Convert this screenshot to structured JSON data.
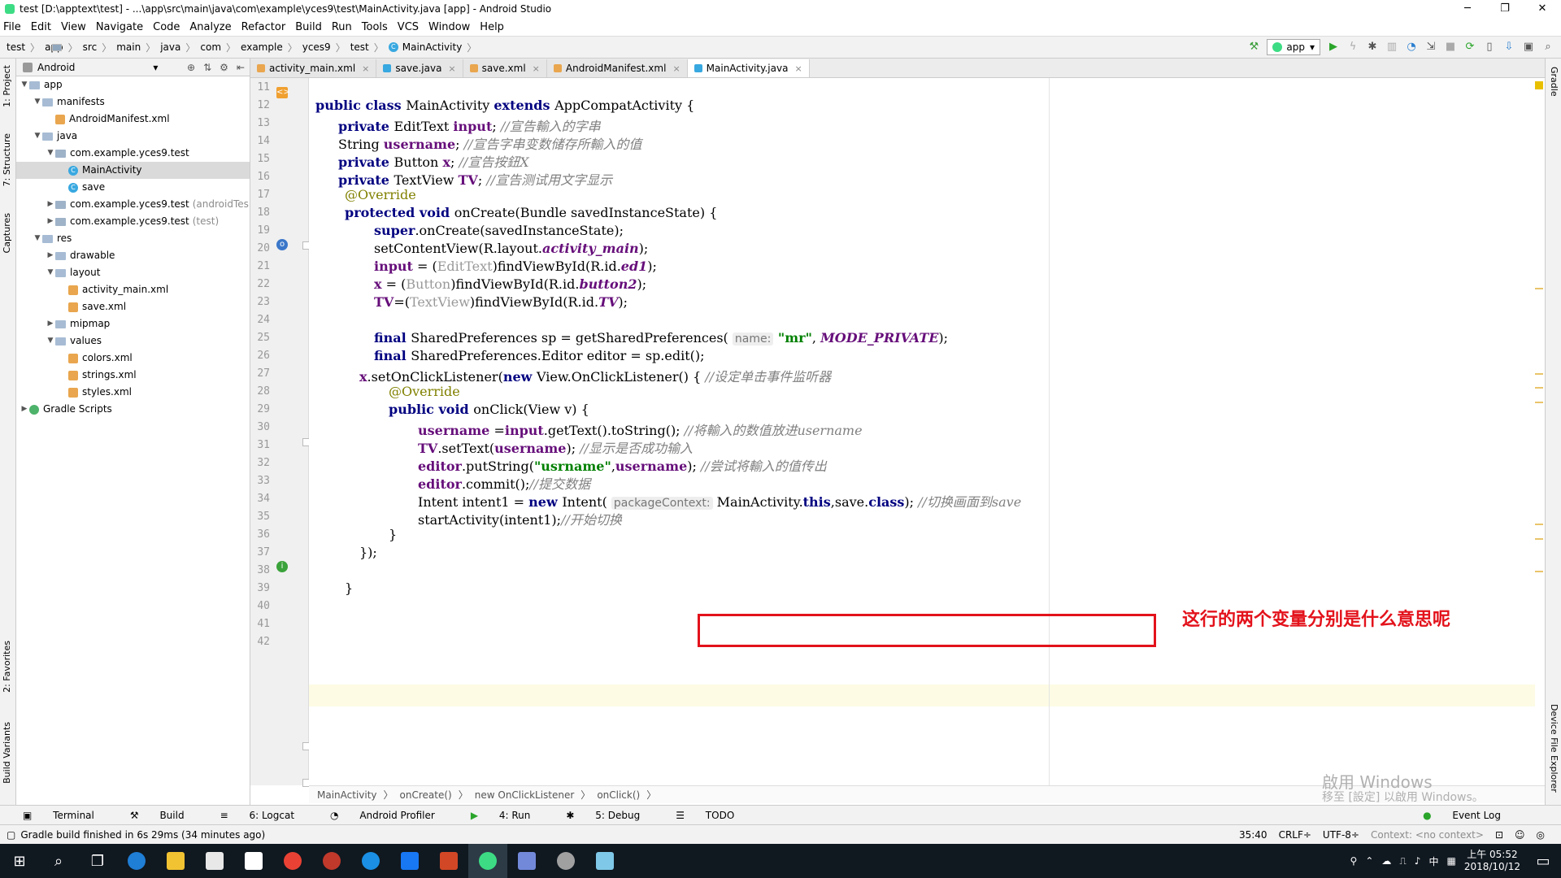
{
  "window": {
    "title": "test [D:\\apptext\\test] - ...\\app\\src\\main\\java\\com\\example\\yces9\\test\\MainActivity.java [app] - Android Studio"
  },
  "menu": [
    "File",
    "Edit",
    "View",
    "Navigate",
    "Code",
    "Analyze",
    "Refactor",
    "Build",
    "Run",
    "Tools",
    "VCS",
    "Window",
    "Help"
  ],
  "breadcrumbs": [
    "test",
    "app",
    "src",
    "main",
    "java",
    "com",
    "example",
    "yces9",
    "test",
    "MainActivity"
  ],
  "run_config": "app",
  "project_panel": {
    "mode": "Android",
    "tree": [
      {
        "label": "app",
        "depth": 0,
        "icon": "folder",
        "arrow": "v"
      },
      {
        "label": "manifests",
        "depth": 1,
        "icon": "folder",
        "arrow": "v"
      },
      {
        "label": "AndroidManifest.xml",
        "depth": 2,
        "icon": "xml",
        "arrow": ""
      },
      {
        "label": "java",
        "depth": 1,
        "icon": "folder",
        "arrow": "v"
      },
      {
        "label": "com.example.yces9.test",
        "depth": 2,
        "icon": "pkg",
        "arrow": "v"
      },
      {
        "label": "MainActivity",
        "depth": 3,
        "icon": "cls",
        "arrow": "",
        "selected": true
      },
      {
        "label": "save",
        "depth": 3,
        "icon": "cls",
        "arrow": ""
      },
      {
        "label": "com.example.yces9.test",
        "suffix": "(androidTes",
        "depth": 2,
        "icon": "pkg",
        "arrow": ">"
      },
      {
        "label": "com.example.yces9.test",
        "suffix": "(test)",
        "depth": 2,
        "icon": "pkg",
        "arrow": ">"
      },
      {
        "label": "res",
        "depth": 1,
        "icon": "folder",
        "arrow": "v"
      },
      {
        "label": "drawable",
        "depth": 2,
        "icon": "folder",
        "arrow": ">"
      },
      {
        "label": "layout",
        "depth": 2,
        "icon": "folder",
        "arrow": "v"
      },
      {
        "label": "activity_main.xml",
        "depth": 3,
        "icon": "xml",
        "arrow": ""
      },
      {
        "label": "save.xml",
        "depth": 3,
        "icon": "xml",
        "arrow": ""
      },
      {
        "label": "mipmap",
        "depth": 2,
        "icon": "folder",
        "arrow": ">"
      },
      {
        "label": "values",
        "depth": 2,
        "icon": "folder",
        "arrow": "v"
      },
      {
        "label": "colors.xml",
        "depth": 3,
        "icon": "xml",
        "arrow": ""
      },
      {
        "label": "strings.xml",
        "depth": 3,
        "icon": "xml",
        "arrow": ""
      },
      {
        "label": "styles.xml",
        "depth": 3,
        "icon": "xml",
        "arrow": ""
      },
      {
        "label": "Gradle Scripts",
        "depth": 0,
        "icon": "grad",
        "arrow": ">"
      }
    ]
  },
  "side_tabs_left": [
    "1: Project",
    "7: Structure",
    "Captures",
    "2: Favorites",
    "Build Variants"
  ],
  "side_tabs_right": [
    "Gradle",
    "Device File Explorer"
  ],
  "editor_tabs": [
    {
      "label": "activity_main.xml",
      "color": "#e9a64e"
    },
    {
      "label": "save.java",
      "color": "#38a8e0"
    },
    {
      "label": "save.xml",
      "color": "#e9a64e"
    },
    {
      "label": "AndroidManifest.xml",
      "color": "#e9a64e"
    },
    {
      "label": "MainActivity.java",
      "color": "#38a8e0",
      "active": true
    }
  ],
  "line_numbers": [
    "11",
    "12",
    "13",
    "14",
    "15",
    "16",
    "17",
    "18",
    "19",
    "20",
    "21",
    "22",
    "23",
    "24",
    "25",
    "26",
    "27",
    "28",
    "29",
    "30",
    "31",
    "32",
    "33",
    "34",
    "35",
    "36",
    "37",
    "38",
    "39",
    "40",
    "41",
    "42"
  ],
  "code": {
    "l12": [
      "public class ",
      "MainActivity ",
      "extends ",
      "AppCompatActivity {"
    ],
    "l13": [
      "private ",
      "EditText ",
      "input",
      "; ",
      "//宣告輸入的字串"
    ],
    "l14": [
      "String ",
      "username",
      "; ",
      "//宣告字串变数储存所輸入的值"
    ],
    "l15": [
      "private ",
      "Button ",
      "x",
      "; ",
      "//宣告按鈕X"
    ],
    "l16": [
      "private ",
      "TextView ",
      "TV",
      "; ",
      "//宣告测试用文字显示"
    ],
    "l17": [
      "@Override"
    ],
    "l18": [
      "protected void ",
      "onCreate(Bundle savedInstanceState) {"
    ],
    "l19": [
      "super",
      ".onCreate(savedInstanceState);"
    ],
    "l20": [
      "setContentView(R.layout.",
      "activity_main",
      ");"
    ],
    "l21": [
      "input",
      " = (",
      "EditText",
      ")findViewById(R.id.",
      "ed1",
      ");"
    ],
    "l22": [
      "x",
      " = (",
      "Button",
      ")findViewById(R.id.",
      "button2",
      ");"
    ],
    "l23": [
      "TV",
      "=(",
      "TextView",
      ")findViewById(R.id.",
      "TV",
      ");"
    ],
    "l25": [
      "final ",
      "SharedPreferences sp = getSharedPreferences( ",
      "name:",
      " \"mr\"",
      ", ",
      "MODE_PRIVATE",
      ");"
    ],
    "l26": [
      "final ",
      "SharedPreferences.Editor editor = sp.edit();"
    ],
    "l27": [
      "x",
      ".setOnClickListener(",
      "new ",
      "View.OnClickListener() { ",
      "//设定单击事件监听器"
    ],
    "l28": [
      "@Override"
    ],
    "l29": [
      "public void ",
      "onClick(View v) {"
    ],
    "l30": [
      "username",
      " =",
      "input",
      ".getText().toString(); ",
      "//将輸入的数值放进username"
    ],
    "l31": [
      "TV",
      ".setText(",
      "username",
      "); ",
      "//显示是否成功输入"
    ],
    "l32": [
      "editor",
      ".putString(",
      "\"usrname\"",
      ",",
      "username",
      "); ",
      "//尝试将輸入的值传出"
    ],
    "l33": [
      "editor",
      ".commit();",
      "//提交数据"
    ],
    "l34": [
      "Intent intent1 = ",
      "new ",
      "Intent( ",
      "packageContext:",
      " MainActivity.",
      "this",
      ",save.",
      "class",
      "); ",
      "//切换画面到save"
    ],
    "l35": [
      "startActivity(intent1);",
      "//开始切换"
    ],
    "l36": [
      "}"
    ],
    "l37": [
      "});"
    ],
    "l39": [
      "}"
    ]
  },
  "annotation": {
    "text": "这行的两个变量分别是什么意思呢"
  },
  "editor_breadcrumb": [
    "MainActivity",
    "onCreate()",
    "new OnClickListener",
    "onClick()"
  ],
  "watermark": {
    "line1": "啟用 Windows",
    "line2": "移至 [設定] 以啟用 Windows。"
  },
  "toolwindows": [
    "Terminal",
    "Build",
    "6: Logcat",
    "Android Profiler",
    "4: Run",
    "5: Debug",
    "TODO"
  ],
  "event_log": "Event Log",
  "status": {
    "message": "Gradle build finished in 6s 29ms (34 minutes ago)",
    "position": "35:40",
    "line_sep": "CRLF÷",
    "encoding": "UTF-8÷",
    "context": "Context: <no context>"
  },
  "taskbar": {
    "time": "上午 05:52",
    "date": "2018/10/12",
    "ime": "中"
  }
}
